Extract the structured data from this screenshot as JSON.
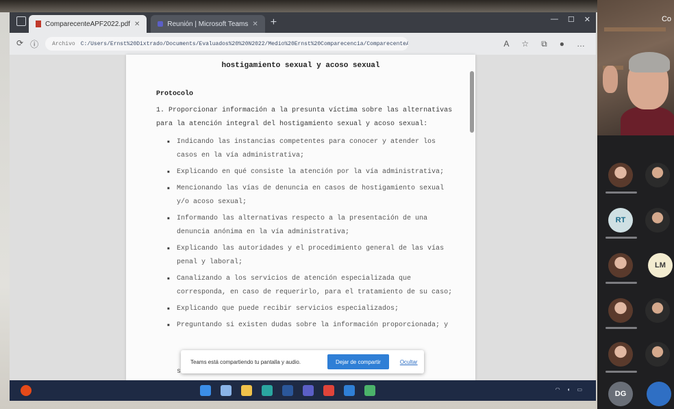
{
  "browser": {
    "tabs": [
      {
        "label": "ComparecenteAPF2022.pdf",
        "active": true
      },
      {
        "label": "Reunión | Microsoft Teams",
        "active": false
      }
    ],
    "new_tab": "+",
    "url": "C:/Users/Ernst%20Dixtrado/Documents/Evaluados%20%20N2022/Medio%20Ernst%20Comparecencia/ComparecenteAPF2022.pdf",
    "url_prefix": "Archivo"
  },
  "document": {
    "title": "hostigamiento sexual y acoso sexual",
    "section": "Protocolo",
    "item1": "1. Proporcionar información a la presunta víctima sobre las alternativas para la atención integral del hostigamiento sexual y acoso sexual:",
    "bullets": [
      "Indicando las instancias competentes para conocer y atender los casos en la vía administrativa;",
      "Explicando en qué consiste la atención por la vía administrativa;",
      "Mencionando las vías de denuncia en casos de hostigamiento sexual y/o acoso sexual;",
      "Informando las alternativas respecto a la presentación de una denuncia anónima en la vía administrativa;",
      "Explicando las autoridades y el procedimiento general de las vías penal y laboral;",
      "Canalizando a los servicios de atención especializada que corresponda, en caso de requerirlo, para el tratamiento de su caso;",
      "Explicando que puede recibir servicios especializados;",
      "Preguntando si existen dudas sobre la información proporcionada; y"
    ],
    "last_line": "sexual establecidas en la vía administrativa."
  },
  "popup": {
    "text": "Teams está compartiendo tu pantalla y audio.",
    "button": "Dejar de compartir",
    "link": "Ocultar"
  },
  "zoom": {
    "speaker_name": "Co",
    "participants": [
      {
        "initials": "",
        "kind": "photo"
      },
      {
        "initials": "",
        "kind": "photo2"
      },
      {
        "initials": "RT",
        "kind": "initials",
        "color": "#cfe0e3",
        "text_color": "#1b6b8a"
      },
      {
        "initials": "",
        "kind": "photo2"
      },
      {
        "initials": "",
        "kind": "photo"
      },
      {
        "initials": "LM",
        "kind": "initials",
        "color": "#f3ecd0",
        "text_color": "#3a3a3a"
      },
      {
        "initials": "",
        "kind": "photo"
      },
      {
        "initials": "",
        "kind": "photo2"
      },
      {
        "initials": "",
        "kind": "photo"
      },
      {
        "initials": "",
        "kind": "photo2"
      },
      {
        "initials": "DG",
        "kind": "initials",
        "color": "#6a6f78",
        "text_color": "#ffffff"
      }
    ]
  }
}
